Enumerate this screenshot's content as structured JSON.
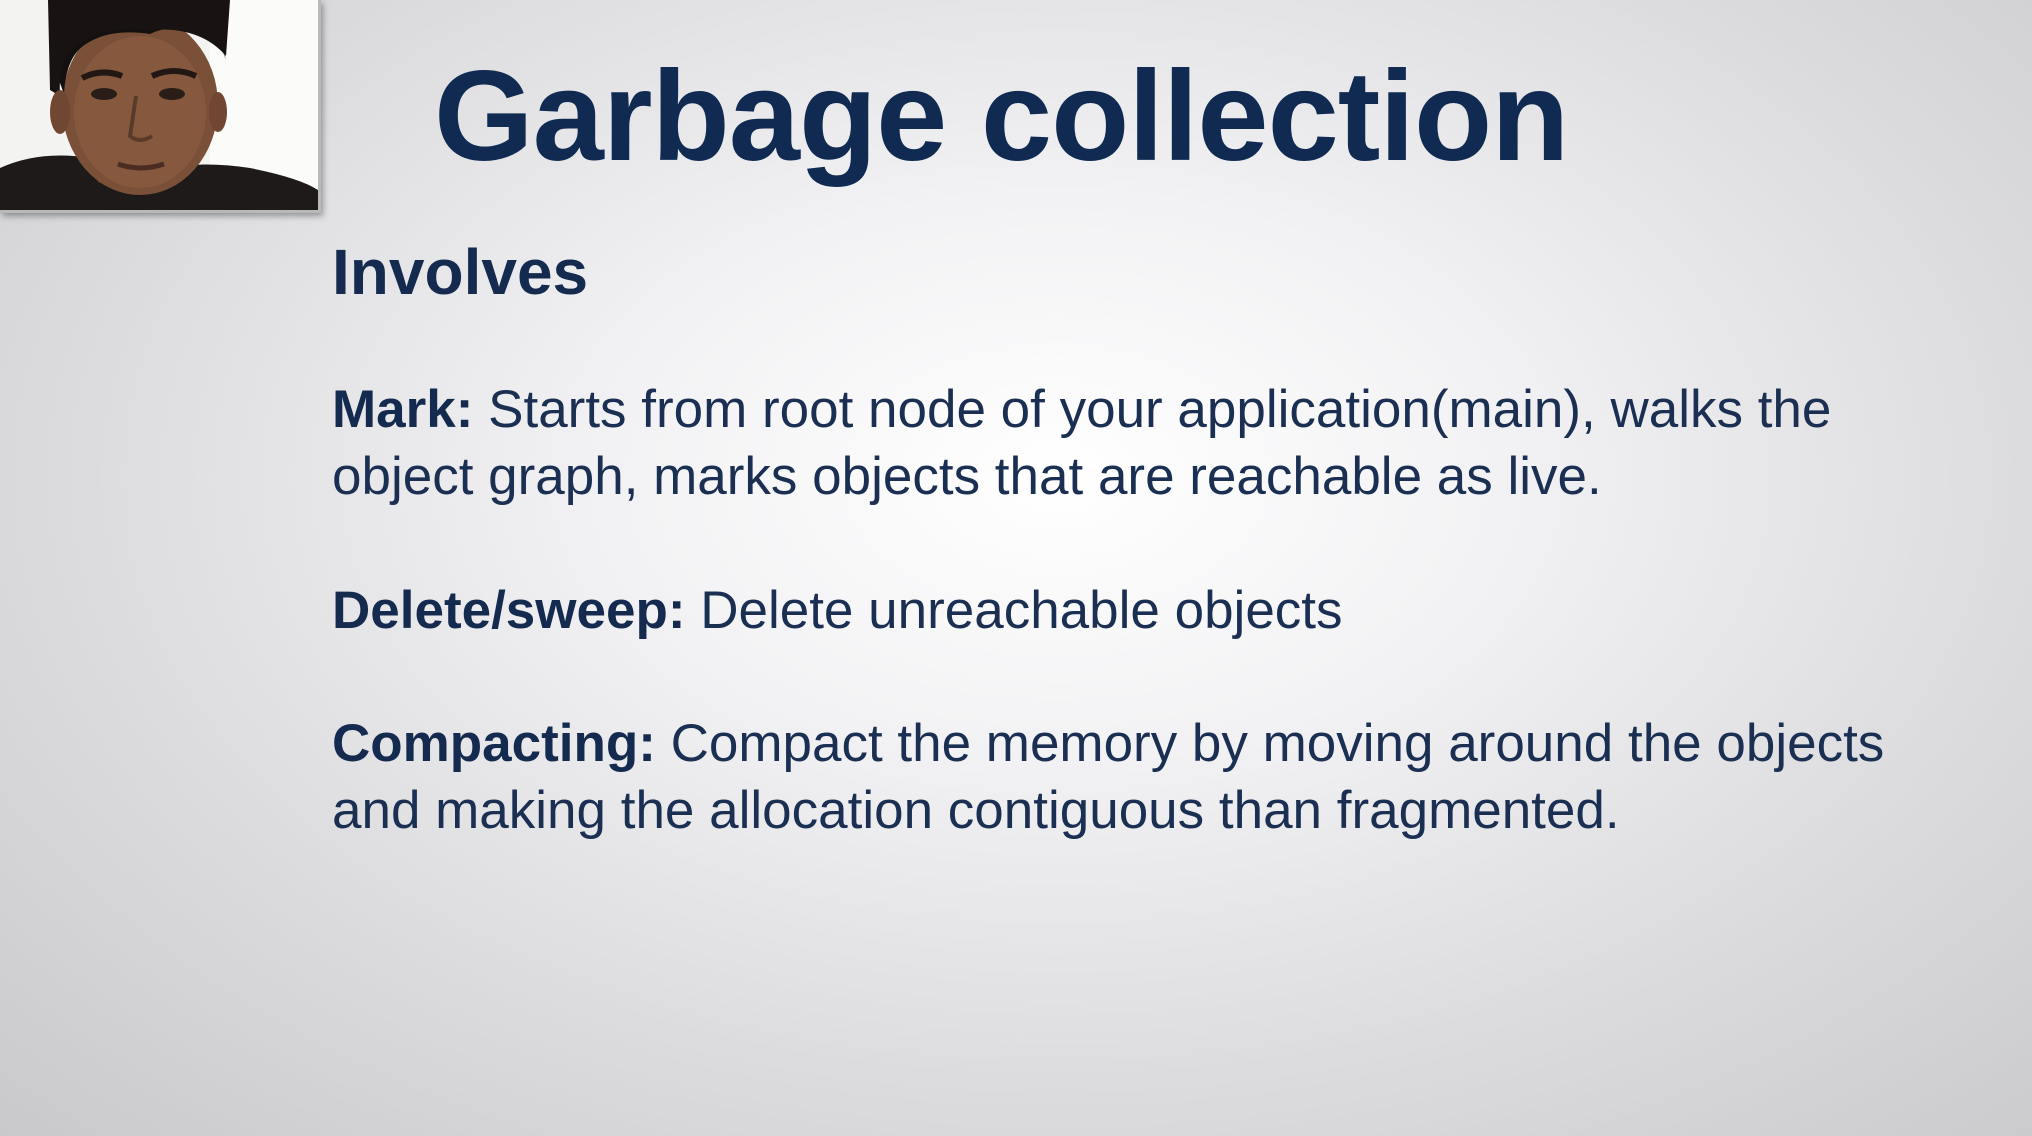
{
  "slide": {
    "title": "Garbage collection",
    "subtitle": "Involves",
    "items": [
      {
        "term": "Mark:",
        "description": " Starts from root node of your application(main), walks the object graph, marks objects that are reachable as live."
      },
      {
        "term": "Delete/sweep:",
        "description": " Delete unreachable objects"
      },
      {
        "term": "Compacting:",
        "description": " Compact the memory by moving around the objects and making the allocation contiguous than fragmented."
      }
    ]
  },
  "webcam": {
    "icon": "presenter-video-icon"
  },
  "colors": {
    "title": "#102a52",
    "text": "#1a2f52",
    "background_center": "#ffffff",
    "background_edge": "#c9c9cc"
  }
}
